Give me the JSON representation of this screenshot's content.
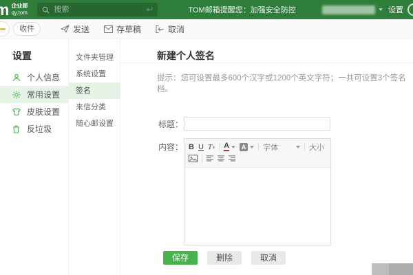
{
  "topbar": {
    "brand_mark": "m",
    "brand_line1": "企业邮",
    "brand_line2": "qy.tom",
    "search_placeholder": "搜索",
    "notice": "TOM邮箱提醒您：加强安全防控",
    "settings_label": "设置"
  },
  "toolbar": {
    "receive": "收件",
    "send": "发送",
    "save_draft": "存草稿",
    "cancel": "取消"
  },
  "sidebar": {
    "title": "设置",
    "items": [
      {
        "label": "个人信息",
        "icon": "user-icon",
        "selected": false
      },
      {
        "label": "常用设置",
        "icon": "gear-icon",
        "selected": true
      },
      {
        "label": "皮肤设置",
        "icon": "tshirt-icon",
        "selected": false
      },
      {
        "label": "反垃圾",
        "icon": "trash-icon",
        "selected": false
      }
    ]
  },
  "submenu": {
    "items": [
      {
        "label": "文件夹管理",
        "selected": false
      },
      {
        "label": "系统设置",
        "selected": false
      },
      {
        "label": "签名",
        "selected": true
      },
      {
        "label": "来信分类",
        "selected": false
      },
      {
        "label": "随心邮设置",
        "selected": false
      }
    ]
  },
  "main": {
    "title": "新建个人签名",
    "hint": "提示：您可设置最多600个汉字或1200个英文字符；一共可设置3个签名档。",
    "form": {
      "title_label": "标题：",
      "title_value": "",
      "content_label": "内容：",
      "editor": {
        "bold": "B",
        "underline": "U",
        "remove_format_t": "T",
        "remove_format_x": "x",
        "font_color": "A",
        "bg_color": "A",
        "font_dropdown": "字体",
        "size_dropdown": "大小"
      },
      "buttons": {
        "save": "保存",
        "delete": "删除",
        "cancel": "取消"
      }
    }
  },
  "colors": {
    "topbar_green": "#2f7d3b",
    "accent_green": "#47b44b",
    "icon_green": "#4eb457",
    "selected_bg": "#e4f3e5"
  }
}
